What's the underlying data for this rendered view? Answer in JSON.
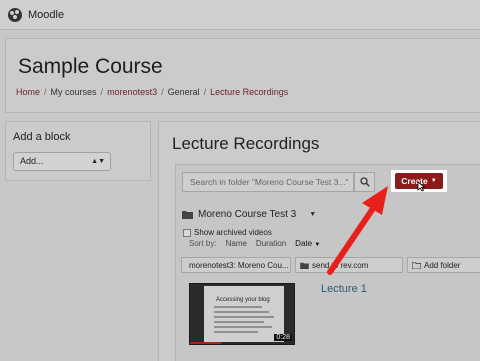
{
  "navbar": {
    "brand": "Moodle"
  },
  "header": {
    "course_title": "Sample Course",
    "breadcrumb": [
      "Home",
      "My courses",
      "morenotest3",
      "General",
      "Lecture Recordings"
    ]
  },
  "add_block": {
    "title": "Add a block",
    "select_value": "Add..."
  },
  "main": {
    "title": "Lecture Recordings",
    "search": {
      "placeholder": "Search in folder \"Moreno Course Test 3...\""
    },
    "create_label": "Create",
    "folder_name": "Moreno Course Test 3",
    "show_archived_label": "Show archived videos",
    "sort": {
      "label": "Sort by:",
      "name": "Name",
      "duration": "Duration",
      "date": "Date"
    },
    "actions": [
      "morenotest3: Moreno Cou...",
      "send to rev.com",
      "Add folder"
    ],
    "video": {
      "title": "Lecture 1",
      "duration": "0:28",
      "progress": 0.3,
      "thumb_heading": "Accessing your blog"
    }
  },
  "colors": {
    "accent": "#8b1a1a",
    "arrow": "#e8201a",
    "link": "#2c5a78"
  },
  "icons": [
    "moodle-logo-icon",
    "search-icon",
    "folder-icon",
    "chevron-down-icon",
    "cursor-icon",
    "annotation-arrow"
  ]
}
